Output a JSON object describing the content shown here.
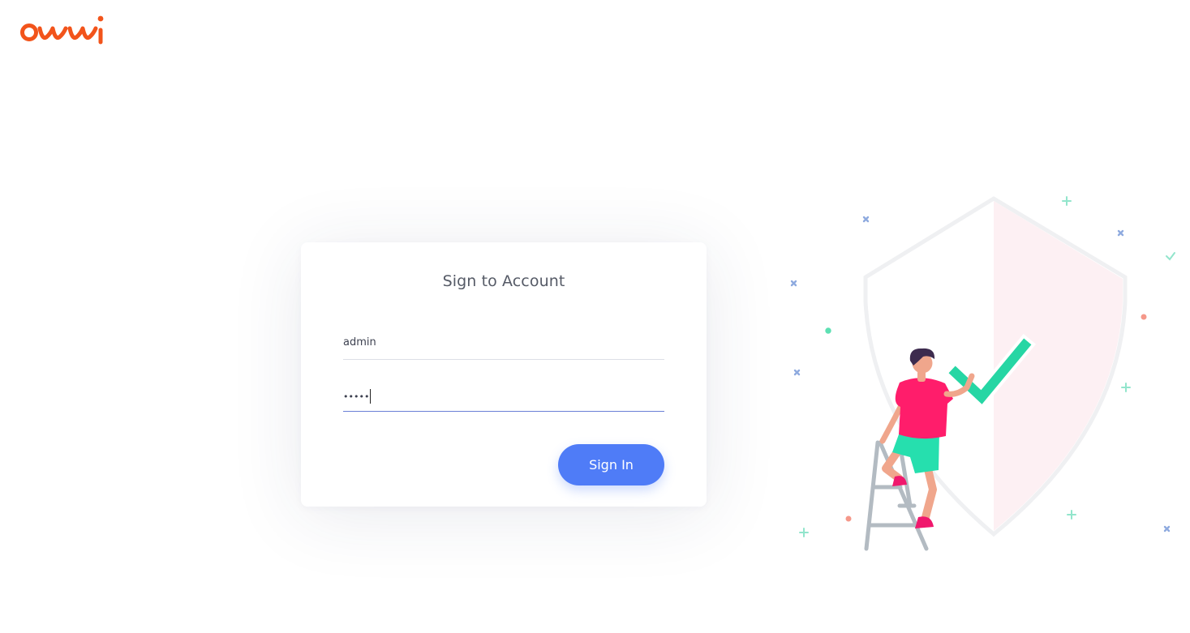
{
  "brand": {
    "logo_text": "owwi",
    "logo_color": "#f2541b"
  },
  "login": {
    "title": "Sign to Account",
    "username_value": "admin",
    "password_value": "•••••",
    "submit_label": "Sign In",
    "accent_color": "#4f7cf7"
  },
  "illustration": {
    "icon": "security-shield-checkmark-illustration"
  }
}
